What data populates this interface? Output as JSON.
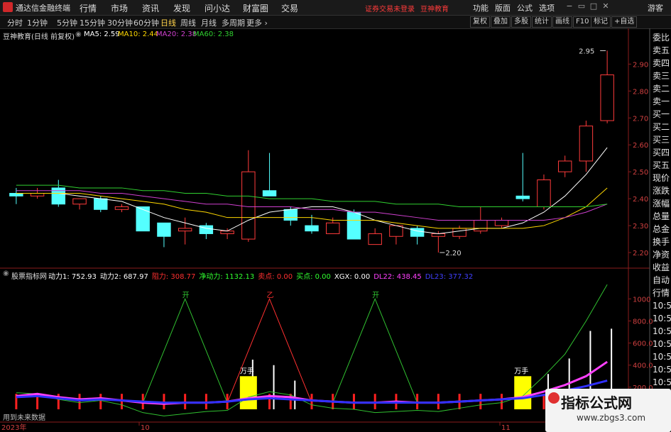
{
  "app": {
    "title": "通达信金融终端"
  },
  "menu": [
    "行情",
    "市场",
    "资讯",
    "发现",
    "问小达",
    "财富圈",
    "交易"
  ],
  "notice": {
    "text1": "证券交易未登录",
    "text2": "豆神教育"
  },
  "right_menu": [
    "功能",
    "版面",
    "公式",
    "选项"
  ],
  "guest_label": "游客",
  "periods": [
    "分时",
    "1分钟",
    "5分钟",
    "15分钟",
    "30分钟",
    "60分钟",
    "日线",
    "周线",
    "月线",
    "多周期",
    "更多"
  ],
  "active_period": "日线",
  "toolbar_right": [
    "复权",
    "叠加",
    "多股",
    "统计",
    "画线",
    "F10",
    "标记",
    "+自选"
  ],
  "legend": {
    "stock": "豆神教育(日线 前复权)",
    "ma5": "MA5: 2.59",
    "ma10": "MA10: 2.44",
    "ma20": "MA20: 2.38",
    "ma60": "MA60: 2.38"
  },
  "indicator": {
    "name": "股票指标网",
    "items": [
      {
        "label": "动力1: 752.93",
        "color": "#ffffff"
      },
      {
        "label": "动力2: 687.97",
        "color": "#ffffff"
      },
      {
        "label": "阻力: 308.77",
        "color": "#ff3030"
      },
      {
        "label": "净动力: 1132.13",
        "color": "#30ff30"
      },
      {
        "label": "卖点: 0.00",
        "color": "#ff3030"
      },
      {
        "label": "买点: 0.00",
        "color": "#30ff30"
      },
      {
        "label": "XGX: 0.00",
        "color": "#ffffff"
      },
      {
        "label": "DL22: 438.45",
        "color": "#ff40ff"
      },
      {
        "label": "DL23: 377.32",
        "color": "#4040ff"
      }
    ]
  },
  "annotations": {
    "high": "2.95",
    "low": "2.20",
    "future_note": "用到未来数据",
    "marker1": "开",
    "marker2": "乙",
    "marker3": "开",
    "wanshou": "万手"
  },
  "price_axis": [
    "2.90",
    "2.80",
    "2.70",
    "2.60",
    "2.50",
    "2.40",
    "2.30",
    "2.20"
  ],
  "ind_axis": [
    "1000",
    "800.0",
    "600.0",
    "400.0",
    "200.0"
  ],
  "date_axis": [
    "2023年",
    "10",
    "11"
  ],
  "side_panel": [
    "委比",
    "卖五",
    "卖四",
    "卖三",
    "卖二",
    "卖一",
    "买一",
    "买二",
    "买三",
    "买四",
    "买五",
    "现价",
    "涨跌",
    "涨幅",
    "总量",
    "总金",
    "换手",
    "净资",
    "收益"
  ],
  "side_panel2": [
    "自动",
    "行情",
    "10:5",
    "10:5",
    "10:5",
    "10:5",
    "10:5",
    "10:5",
    "10:5",
    "10:5"
  ],
  "watermark": {
    "line1": "指标公式网",
    "line2": "www.zbgs3.com"
  },
  "chart_data": {
    "type": "candlestick",
    "ylim": [
      2.15,
      2.98
    ],
    "candles": [
      {
        "o": 2.42,
        "h": 2.44,
        "l": 2.38,
        "c": 2.41
      },
      {
        "o": 2.41,
        "h": 2.44,
        "l": 2.4,
        "c": 2.42
      },
      {
        "o": 2.44,
        "h": 2.47,
        "l": 2.37,
        "c": 2.38
      },
      {
        "o": 2.38,
        "h": 2.4,
        "l": 2.36,
        "c": 2.4
      },
      {
        "o": 2.4,
        "h": 2.41,
        "l": 2.35,
        "c": 2.36
      },
      {
        "o": 2.36,
        "h": 2.38,
        "l": 2.35,
        "c": 2.37
      },
      {
        "o": 2.37,
        "h": 2.37,
        "l": 2.28,
        "c": 2.28
      },
      {
        "o": 2.31,
        "h": 2.31,
        "l": 2.22,
        "c": 2.26
      },
      {
        "o": 2.28,
        "h": 2.33,
        "l": 2.23,
        "c": 2.29
      },
      {
        "o": 2.3,
        "h": 2.31,
        "l": 2.25,
        "c": 2.27
      },
      {
        "o": 2.27,
        "h": 2.29,
        "l": 2.25,
        "c": 2.28
      },
      {
        "o": 2.25,
        "h": 2.58,
        "l": 2.24,
        "c": 2.5
      },
      {
        "o": 2.43,
        "h": 2.57,
        "l": 2.41,
        "c": 2.41
      },
      {
        "o": 2.36,
        "h": 2.37,
        "l": 2.3,
        "c": 2.32
      },
      {
        "o": 2.3,
        "h": 2.34,
        "l": 2.27,
        "c": 2.28
      },
      {
        "o": 2.27,
        "h": 2.33,
        "l": 2.27,
        "c": 2.31
      },
      {
        "o": 2.35,
        "h": 2.36,
        "l": 2.25,
        "c": 2.25
      },
      {
        "o": 2.23,
        "h": 2.29,
        "l": 2.23,
        "c": 2.27
      },
      {
        "o": 2.26,
        "h": 2.3,
        "l": 2.23,
        "c": 2.3
      },
      {
        "o": 2.29,
        "h": 2.3,
        "l": 2.23,
        "c": 2.26
      },
      {
        "o": 2.26,
        "h": 2.28,
        "l": 2.2,
        "c": 2.27
      },
      {
        "o": 2.26,
        "h": 2.3,
        "l": 2.25,
        "c": 2.29
      },
      {
        "o": 2.28,
        "h": 2.37,
        "l": 2.27,
        "c": 2.32
      },
      {
        "o": 2.3,
        "h": 2.33,
        "l": 2.29,
        "c": 2.32
      },
      {
        "o": 2.41,
        "h": 2.57,
        "l": 2.39,
        "c": 2.4
      },
      {
        "o": 2.37,
        "h": 2.49,
        "l": 2.36,
        "c": 2.47
      },
      {
        "o": 2.5,
        "h": 2.56,
        "l": 2.48,
        "c": 2.54
      },
      {
        "o": 2.54,
        "h": 2.69,
        "l": 2.5,
        "c": 2.67
      },
      {
        "o": 2.69,
        "h": 2.95,
        "l": 2.68,
        "c": 2.86
      }
    ],
    "series": [
      {
        "name": "MA5",
        "color": "#ffffff",
        "values": [
          2.42,
          2.42,
          2.42,
          2.41,
          2.4,
          2.39,
          2.36,
          2.33,
          2.31,
          2.29,
          2.28,
          2.32,
          2.35,
          2.36,
          2.37,
          2.37,
          2.35,
          2.32,
          2.3,
          2.28,
          2.27,
          2.28,
          2.29,
          2.29,
          2.31,
          2.35,
          2.41,
          2.49,
          2.59
        ]
      },
      {
        "name": "MA10",
        "color": "#ffd800",
        "values": [
          2.42,
          2.42,
          2.42,
          2.42,
          2.41,
          2.4,
          2.39,
          2.38,
          2.36,
          2.35,
          2.33,
          2.33,
          2.33,
          2.33,
          2.33,
          2.32,
          2.32,
          2.32,
          2.31,
          2.3,
          2.29,
          2.29,
          2.29,
          2.29,
          2.29,
          2.3,
          2.33,
          2.37,
          2.44
        ]
      },
      {
        "name": "MA20",
        "color": "#d040d0",
        "values": [
          2.43,
          2.43,
          2.43,
          2.43,
          2.42,
          2.42,
          2.41,
          2.4,
          2.39,
          2.38,
          2.38,
          2.37,
          2.37,
          2.37,
          2.36,
          2.36,
          2.35,
          2.35,
          2.34,
          2.33,
          2.32,
          2.32,
          2.32,
          2.32,
          2.32,
          2.32,
          2.33,
          2.35,
          2.38
        ]
      },
      {
        "name": "MA60",
        "color": "#30d030",
        "values": [
          2.45,
          2.45,
          2.45,
          2.44,
          2.44,
          2.44,
          2.43,
          2.43,
          2.42,
          2.42,
          2.41,
          2.41,
          2.4,
          2.4,
          2.4,
          2.39,
          2.39,
          2.39,
          2.38,
          2.38,
          2.38,
          2.37,
          2.37,
          2.37,
          2.37,
          2.37,
          2.37,
          2.37,
          2.38
        ]
      }
    ],
    "indicator": {
      "ylim": [
        0,
        1150
      ],
      "green": [
        150,
        140,
        90,
        60,
        80,
        40,
        -30,
        -60,
        -40,
        -20,
        -10,
        110,
        160,
        130,
        40,
        10,
        0,
        -30,
        -20,
        -10,
        -20,
        10,
        40,
        60,
        120,
        300,
        500,
        800,
        1130
      ],
      "peaks": [
        220,
        1000,
        1000,
        850
      ],
      "magenta": [
        120,
        140,
        110,
        90,
        100,
        80,
        60,
        50,
        60,
        60,
        70,
        100,
        120,
        110,
        80,
        70,
        60,
        60,
        70,
        60,
        60,
        70,
        80,
        90,
        110,
        160,
        220,
        300,
        430
      ],
      "blue": [
        110,
        120,
        100,
        80,
        90,
        80,
        70,
        60,
        60,
        60,
        70,
        90,
        100,
        90,
        80,
        70,
        60,
        60,
        60,
        60,
        60,
        70,
        80,
        90,
        100,
        130,
        170,
        210,
        260
      ],
      "white_bars": [
        0,
        0,
        0,
        0,
        0,
        0,
        0,
        0,
        0,
        0,
        0,
        450,
        400,
        260,
        0,
        0,
        0,
        0,
        0,
        0,
        0,
        0,
        0,
        0,
        0,
        320,
        460,
        710,
        730
      ]
    }
  }
}
